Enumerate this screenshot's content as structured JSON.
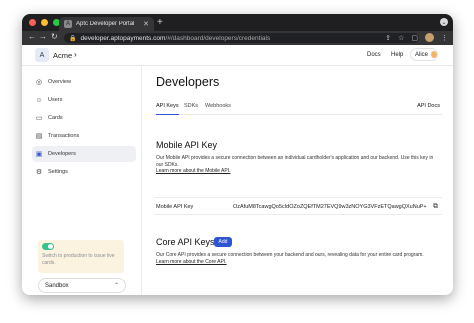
{
  "browser": {
    "tab_title": "Aptc Developer Portal",
    "tab_close": "✕",
    "new_tab": "+",
    "url_host": "developer.aptopayments.com",
    "url_path": "/#/dashboard/developers/credentials",
    "traffic_lights": [
      "#fe5f57",
      "#febc2e",
      "#28c840"
    ]
  },
  "topnav": {
    "org_initial": "A",
    "org_name": "Acme",
    "docs": "Docs",
    "help": "Help",
    "user_name": "Alice"
  },
  "sidebar": {
    "items": [
      {
        "label": "Overview",
        "icon": "overview-icon",
        "glyph": "◎",
        "active": false
      },
      {
        "label": "Users",
        "icon": "users-icon",
        "glyph": "☺",
        "active": false
      },
      {
        "label": "Cards",
        "icon": "cards-icon",
        "glyph": "▭",
        "active": false
      },
      {
        "label": "Transactions",
        "icon": "transactions-icon",
        "glyph": "▤",
        "active": false
      },
      {
        "label": "Developers",
        "icon": "developers-icon",
        "glyph": "▣",
        "active": true
      },
      {
        "label": "Settings",
        "icon": "settings-icon",
        "glyph": "⚙",
        "active": false
      }
    ],
    "promo_text": "Switch to production to issue live cards.",
    "environment": "Sandbox"
  },
  "main": {
    "title": "Developers",
    "tabs": [
      {
        "label": "API Keys",
        "active": true
      },
      {
        "label": "SDKs",
        "active": false
      },
      {
        "label": "Webhooks",
        "active": false
      }
    ],
    "api_docs": "API Docs",
    "mobile": {
      "title": "Mobile API Key",
      "description": "Our Mobile API provides a secure connection between an individual cardholder's application and our backend. Use this key in our SDKs.",
      "link": "Learn more about the Mobile API.",
      "key_label": "Mobile API Key",
      "key_value": "OzAfuM8TcawgQo5cIdOZoZQEfTM27EVQ9w3zNOYG3VFzETQawgQXuNuP+"
    },
    "core": {
      "title": "Core API Keys",
      "add_label": "Add",
      "description": "Our Core API provides a secure connection between your backend and ours, revealing data for your entire card program.",
      "link": "Learn more about the Core API."
    }
  }
}
